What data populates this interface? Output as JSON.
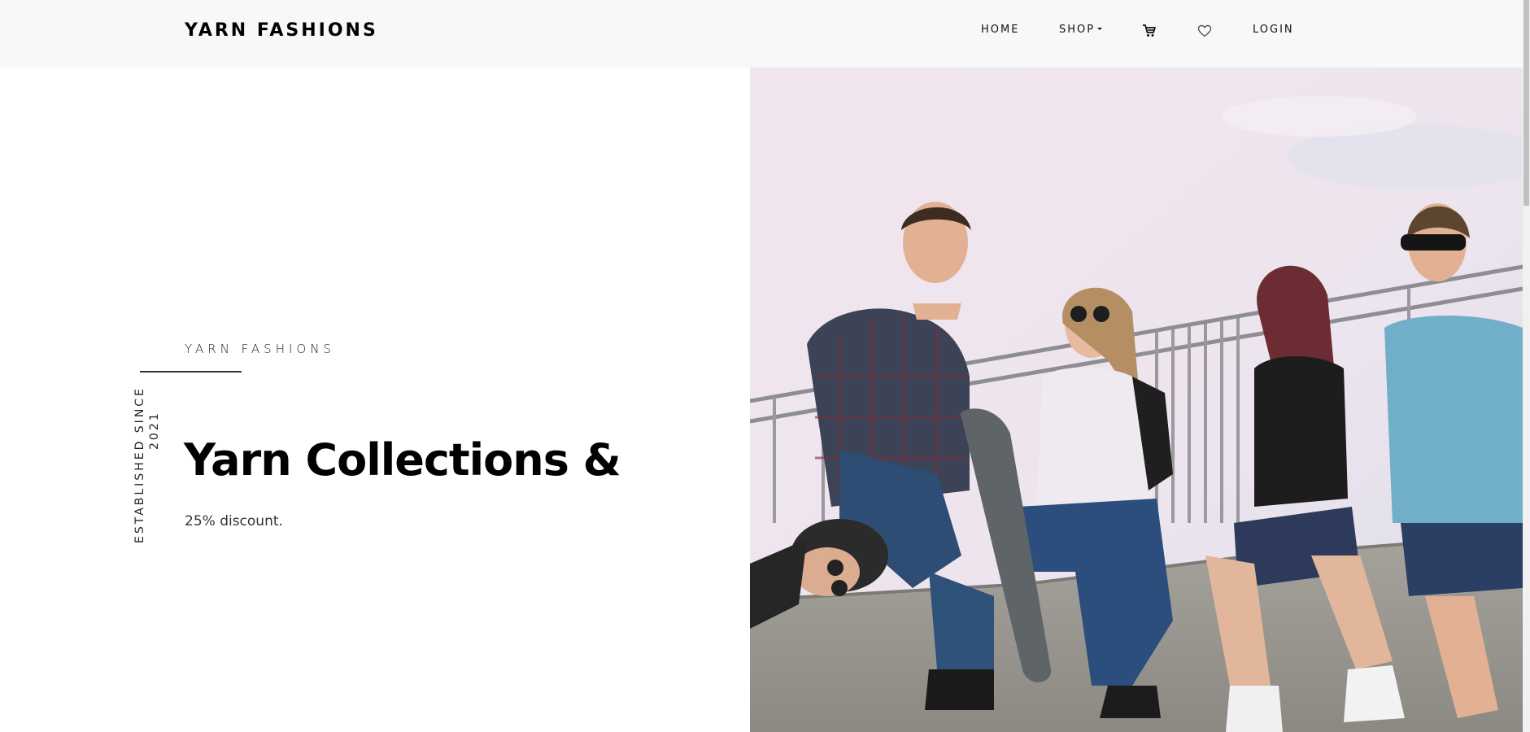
{
  "navbar": {
    "brand": "YARN FASHIONS",
    "links": {
      "home": "HOME",
      "shop": "SHOP",
      "login": "LOGIN"
    },
    "icons": [
      "cart-icon",
      "heart-icon",
      "chevron-down-icon"
    ]
  },
  "hero": {
    "eyebrow": "YARN FASHIONS",
    "established": "ESTABLISHED SINCE",
    "year": "2021",
    "headline": "Yarn Collections &",
    "subtext": "25% discount."
  },
  "colors": {
    "navbar_bg": "#f7f8fa",
    "text": "#000000",
    "sky": "#ece3ec",
    "concrete": "#9a9893"
  }
}
